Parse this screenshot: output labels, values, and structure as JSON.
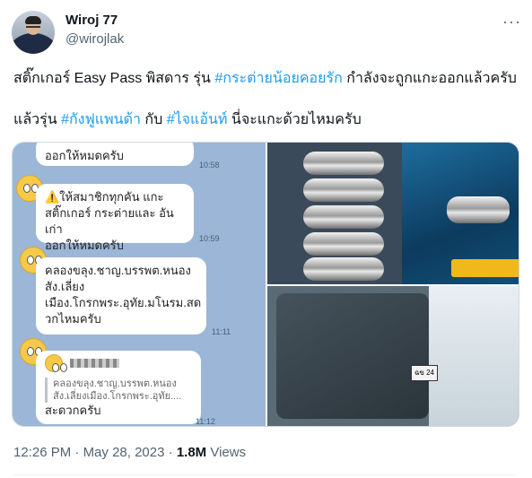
{
  "author": {
    "name": "Wiroj 77",
    "handle": "@wirojlak"
  },
  "tweet": {
    "line1_text": "สติ๊กเกอร์ Easy Pass พิสดาร รุ่น ",
    "line1_tag": "#กระต่ายน้อยคอยรัก",
    "line1_tail": " กำลังจะถูกแกะออกแล้วครับ",
    "line2_text": "แล้วรุ่น ",
    "line2_tag1": "#กังฟูแพนด้า",
    "line2_mid": " กับ ",
    "line2_tag2": "#ไจแอ้นท์",
    "line2_tail": " นี่จะแกะด้วยไหมครับ"
  },
  "chat": {
    "msg0": "ออกให้หมดครับ",
    "msg0_time": "10:58",
    "msg1_line1": "⚠️ให้สมาชิกทุกคัน แกะ",
    "msg1_line2": "สติ๊กเกอร์ กระต่ายและ อันเก่า",
    "msg1_line3": "ออกให้หมดครับ",
    "msg1_time": "10:59",
    "msg2_line1": "คลองขลุง.ชาญ.บรรพต.หนอง",
    "msg2_line2": "สัง.เลี่ยง",
    "msg2_line3": "เมือง.โกรกพระ.อุทัย.มโนรม.สด",
    "msg2_line4": "วกไหมครับ",
    "msg2_time": "11:11",
    "quote_line1": "คลองขลุง.ชาญ.บรรพต.หนอง",
    "quote_line2": "สัง.เลี่ยงเมือง.โกรกพระ.อุทัย....",
    "msg3": "สะดวกครับ",
    "msg3_time": "11:12"
  },
  "photo": {
    "plate_text": "ฉข 24"
  },
  "footer": {
    "time": "12:26 PM",
    "sep": " · ",
    "date": "May 28, 2023",
    "views_count": "1.8M",
    "views_label": " Views"
  },
  "icons": {
    "more": "more-horizontal-icon"
  },
  "colors": {
    "link": "#1d9bf0",
    "secondary_text": "#536471",
    "border": "#cfd9de"
  }
}
